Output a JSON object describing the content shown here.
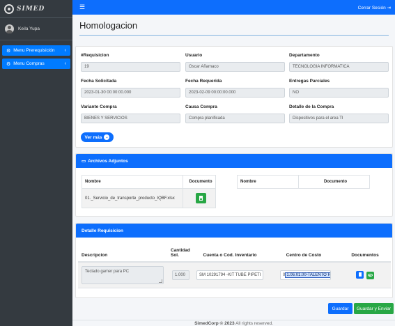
{
  "sidebar": {
    "brand": "SIMED",
    "user_name": "Keila Yupa",
    "items": [
      {
        "label": "Menu Prerequisición"
      },
      {
        "label": "Menu Compras"
      }
    ]
  },
  "topbar": {
    "logout_label": "Cerrar Sesión"
  },
  "page": {
    "title": "Homologacion"
  },
  "requisition": {
    "fields": [
      {
        "label": "#Requisicion",
        "value": "19"
      },
      {
        "label": "Usuario",
        "value": "Oscar Añamaco"
      },
      {
        "label": "Departamento",
        "value": "TECNOLOGIA INFORMATICA"
      },
      {
        "label": "Fecha Solicitada",
        "value": "2023-01-30 00:00:00.000"
      },
      {
        "label": "Fecha Requerida",
        "value": "2023-02-09 00:00:00.000"
      },
      {
        "label": "Entregas Parciales",
        "value": "NO"
      },
      {
        "label": "Variante Compra",
        "value": "BIENES Y SERVICIOS"
      },
      {
        "label": "Causa Compra",
        "value": "Compra planificada"
      },
      {
        "label": "Detalle de la Compra",
        "value": "Dispositivos para el area TI"
      }
    ],
    "ver_mas_label": "Ver más"
  },
  "attachments": {
    "header": "Archivos Adjuntos",
    "left_table": {
      "columns": [
        "Nombre",
        "Documento"
      ],
      "rows": [
        {
          "nombre": "01._Servicio_de_transporte_producto_IQBF.xlsx"
        }
      ]
    },
    "right_table": {
      "columns": [
        "Nombre",
        "Documento"
      ]
    }
  },
  "detail": {
    "header": "Detalle Requisicion",
    "columns": [
      "Descripcion",
      "Cantidad Sol.",
      "Cuenta o Cod. Inventario",
      "Centro de Costo",
      "Documentos"
    ],
    "rows": [
      {
        "descripcion": "Teclado gamer para PC",
        "cantidad": "1.000",
        "cuenta": "SM 10291794 -KIT TUBE PIPETI",
        "centro_prefix": "0",
        "centro_selected": "1.06.01.00-TALENTO H"
      }
    ]
  },
  "actions": {
    "save_label": "Guardar",
    "save_send_label": "Guardar y Enviar"
  },
  "footer": {
    "brand": "SimedCorp © 2023",
    "rights": " All rights reserved."
  }
}
